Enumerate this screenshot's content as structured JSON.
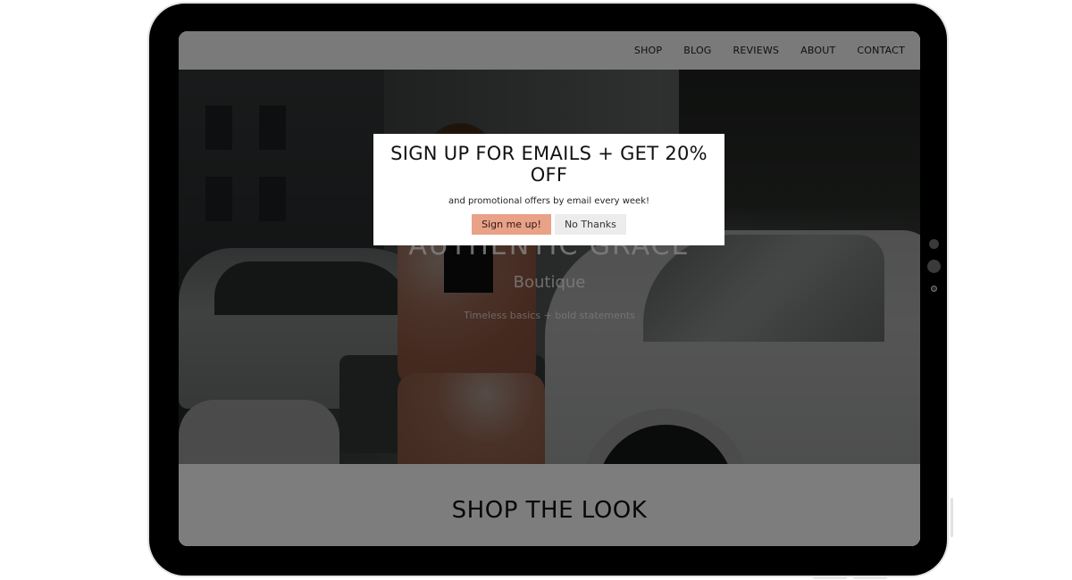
{
  "nav": {
    "items": [
      "SHOP",
      "BLOG",
      "REVIEWS",
      "ABOUT",
      "CONTACT"
    ]
  },
  "hero": {
    "brand_name": "AUTHENTIC GRACE",
    "brand_sub": "Boutique",
    "tagline": "Timeless basics + bold statements"
  },
  "section": {
    "title": "SHOP THE LOOK"
  },
  "modal": {
    "title": "SIGN UP FOR EMAILS + GET 20% OFF",
    "text": "and promotional offers by email every week!",
    "signup_label": "Sign me up!",
    "nothanks_label": "No Thanks"
  },
  "colors": {
    "accent": "#e9a188",
    "nav_bg": "#f4f4f4",
    "device_frame": "#000000"
  }
}
